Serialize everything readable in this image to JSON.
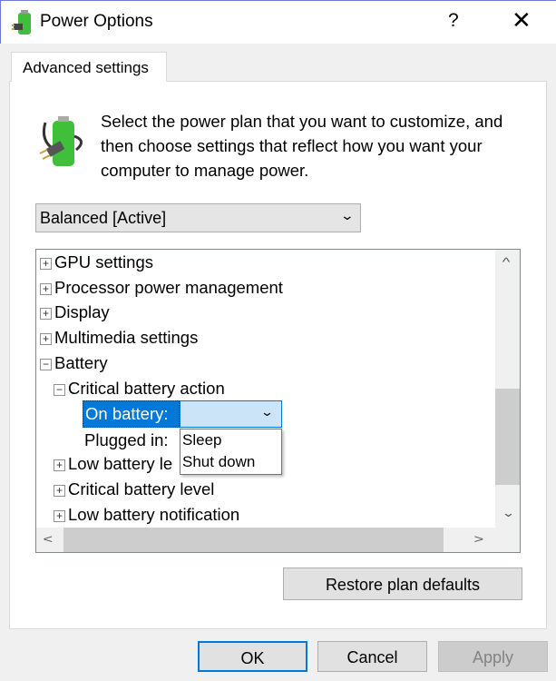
{
  "window": {
    "title": "Power Options",
    "help_label": "?",
    "close_label": "✕"
  },
  "tab": {
    "label": "Advanced settings"
  },
  "description": "Select the power plan that you want to customize, and then choose settings that reflect how you want your computer to manage power.",
  "plan_select": {
    "value": "Balanced [Active]"
  },
  "tree": {
    "items": [
      {
        "label": "GPU settings",
        "state": "+"
      },
      {
        "label": "Processor power management",
        "state": "+"
      },
      {
        "label": "Display",
        "state": "+"
      },
      {
        "label": "Multimedia settings",
        "state": "+"
      },
      {
        "label": "Battery",
        "state": "−"
      },
      {
        "label": "Critical battery action",
        "state": "−"
      },
      {
        "label": "Low battery le",
        "state": "+"
      },
      {
        "label": "Critical battery level",
        "state": "+"
      },
      {
        "label": "Low battery notification",
        "state": "+"
      }
    ],
    "on_battery_label": "On battery:",
    "plugged_in_label": "Plugged in:",
    "dropdown_options": [
      "Sleep",
      "Shut down"
    ]
  },
  "buttons": {
    "restore": "Restore plan defaults",
    "ok": "OK",
    "cancel": "Cancel",
    "apply": "Apply"
  },
  "colors": {
    "accent": "#0078d7",
    "selection_bg": "#cce4f7"
  }
}
